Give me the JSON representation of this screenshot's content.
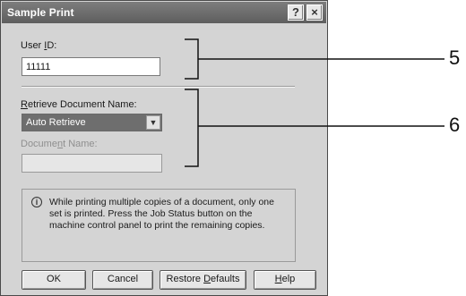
{
  "dialog": {
    "title": "Sample Print",
    "help_button": "?",
    "close_button": "×"
  },
  "user_id": {
    "label_pre": "User ",
    "label_accel": "I",
    "label_post": "D:",
    "value": "11111"
  },
  "retrieve": {
    "label_accel": "R",
    "label_post": "etrieve Document Name:",
    "selected": "Auto Retrieve"
  },
  "document_name": {
    "label_pre": "Docume",
    "label_accel": "n",
    "label_post": "t Name:",
    "value": ""
  },
  "note": {
    "icon": "i",
    "text": "While printing multiple copies of a document, only one set is printed. Press the Job Status button on the machine control panel to print the remaining copies."
  },
  "buttons": {
    "ok": "OK",
    "cancel": "Cancel",
    "restore_pre": "Restore ",
    "restore_accel": "D",
    "restore_post": "efaults",
    "help_accel": "H",
    "help_post": "elp"
  },
  "annotations": {
    "label_5": "5",
    "label_6": "6"
  },
  "icons": {
    "note_icon": "info-icon",
    "dropdown_icon": "chevron-down-icon"
  }
}
